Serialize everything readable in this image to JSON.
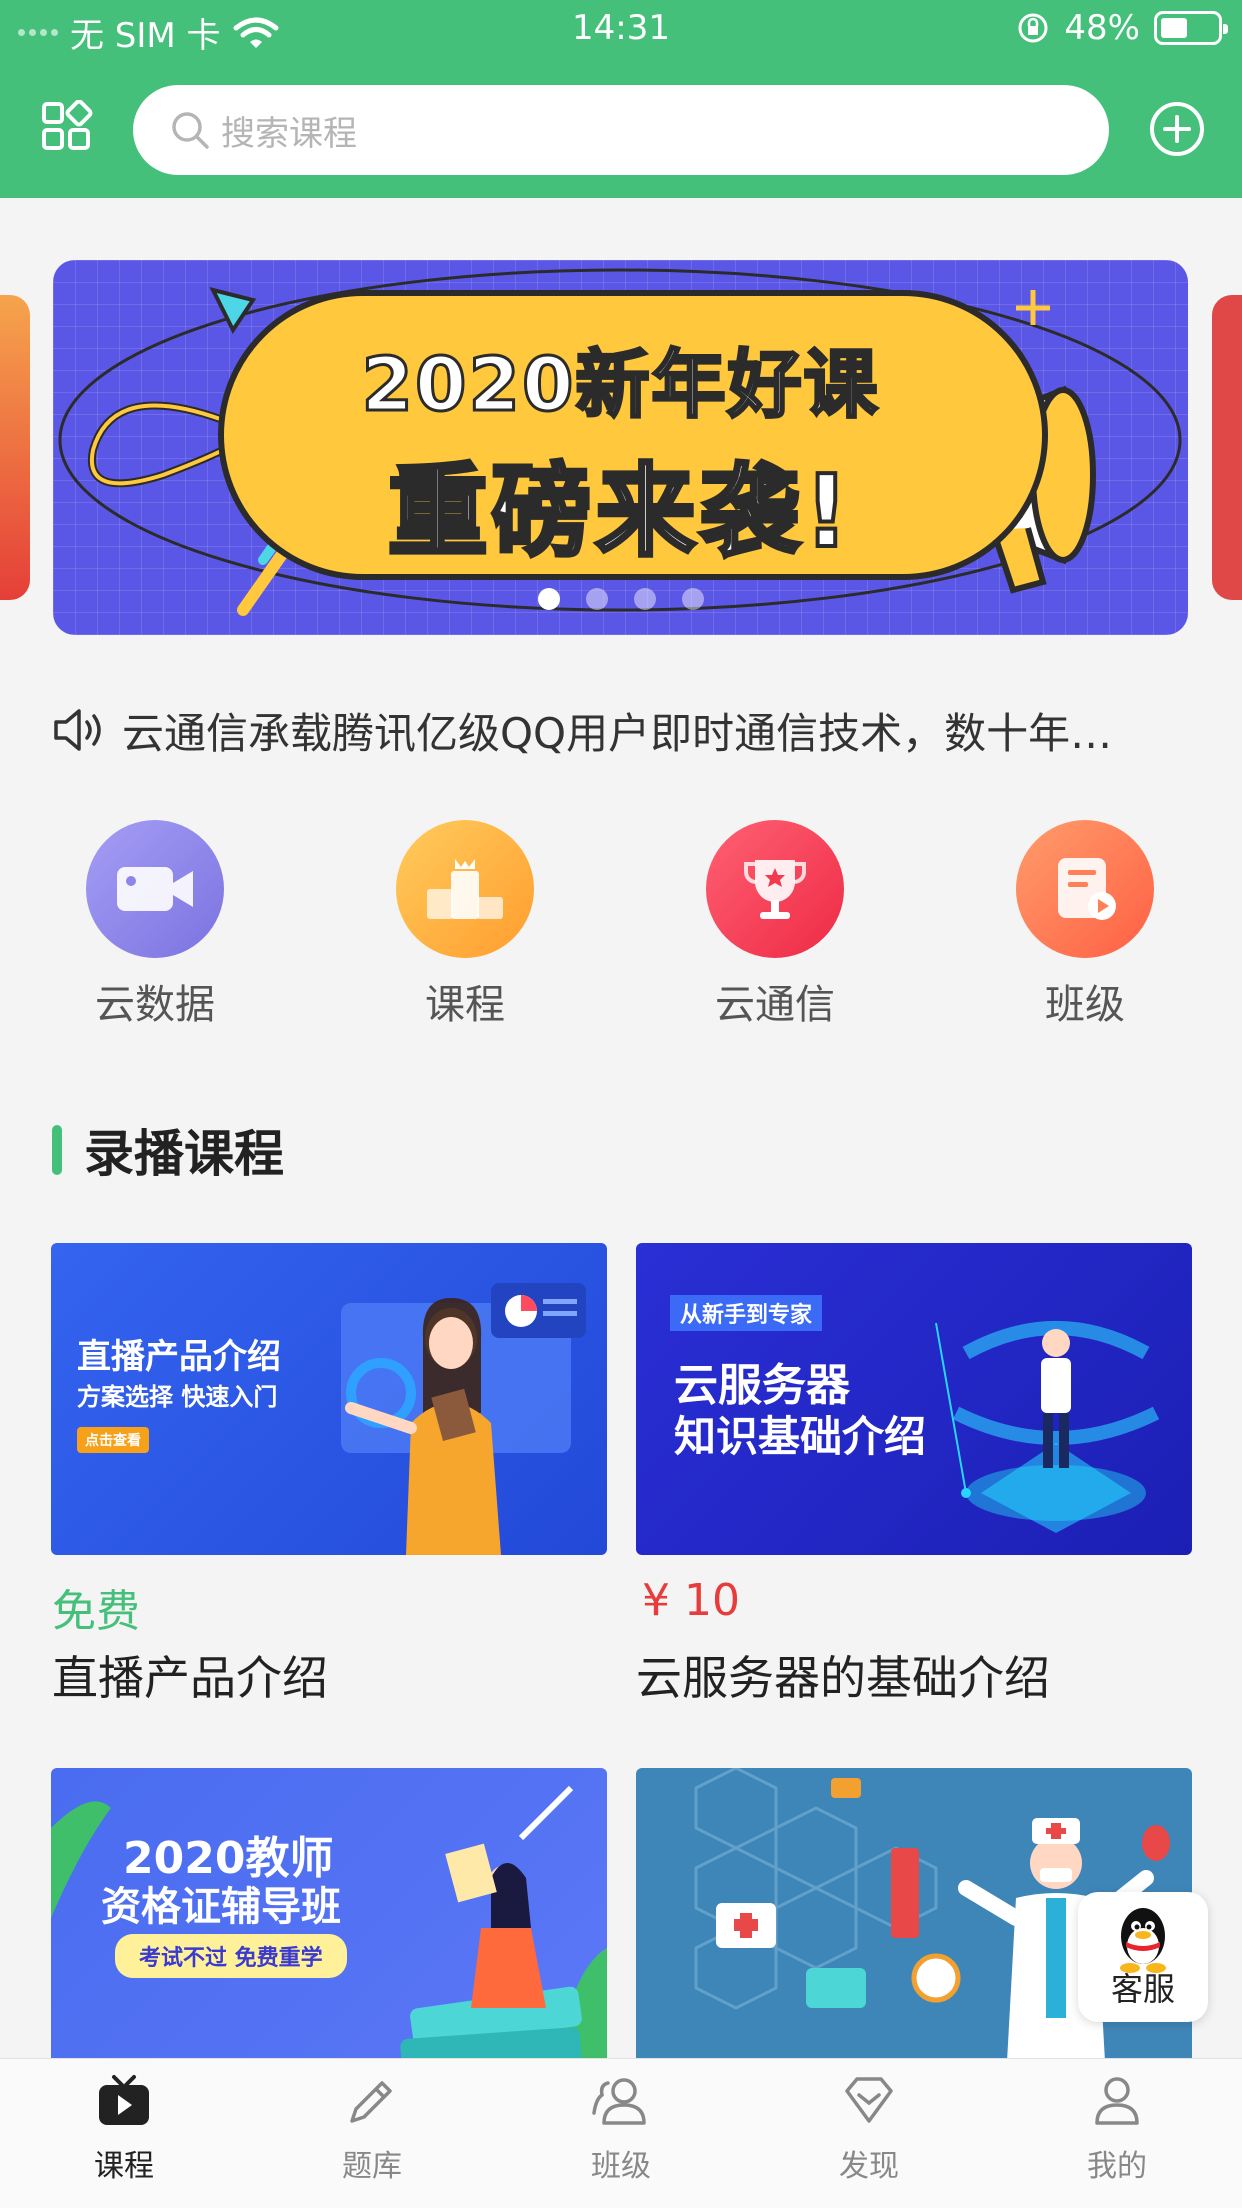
{
  "status_bar": {
    "carrier": "无 SIM 卡",
    "time": "14:31",
    "battery": "48%",
    "battery_level": 0.48
  },
  "header": {
    "search_placeholder": "搜索课程",
    "icons": [
      "apps-grid-icon",
      "search-icon",
      "add-circle-icon"
    ]
  },
  "banner": {
    "line1": "2020新年好课",
    "line2": "重磅来袭!",
    "slides": 4,
    "active_slide": 1
  },
  "notice": {
    "text": "云通信承载腾讯亿级QQ用户即时通信技术，数十年…"
  },
  "categories": [
    {
      "label": "云数据",
      "icon": "video-camera-icon",
      "color": "#8d86ea"
    },
    {
      "label": "课程",
      "icon": "podium-icon",
      "color": "#ffb33f"
    },
    {
      "label": "云通信",
      "icon": "trophy-icon",
      "color": "#f2394f"
    },
    {
      "label": "班级",
      "icon": "document-play-icon",
      "color": "#ff7f57"
    }
  ],
  "section": {
    "title": "录播课程"
  },
  "courses": [
    {
      "price": "免费",
      "price_color": "#45c07a",
      "title": "直播产品介绍",
      "cover": {
        "headline": "直播产品介绍",
        "sub": "方案选择 快速入门",
        "button": "点击查看"
      }
    },
    {
      "price": "¥ 10",
      "price_color": "#e83b3b",
      "title": "云服务器的基础介绍",
      "cover": {
        "tag": "从新手到专家",
        "headline1": "云服务器",
        "headline2": "知识基础介绍"
      }
    },
    {
      "cover": {
        "headline1": "2020教师",
        "headline2": "资格证辅导班",
        "pill": "考试不过 免费重学"
      }
    },
    {
      "cover": {}
    }
  ],
  "floating": {
    "label": "客服"
  },
  "tabbar": [
    {
      "label": "课程",
      "icon": "tv-play-icon",
      "active": true
    },
    {
      "label": "题库",
      "icon": "pencil-icon",
      "active": false
    },
    {
      "label": "班级",
      "icon": "group-icon",
      "active": false
    },
    {
      "label": "发现",
      "icon": "diamond-icon",
      "active": false
    },
    {
      "label": "我的",
      "icon": "user-icon",
      "active": false
    }
  ]
}
